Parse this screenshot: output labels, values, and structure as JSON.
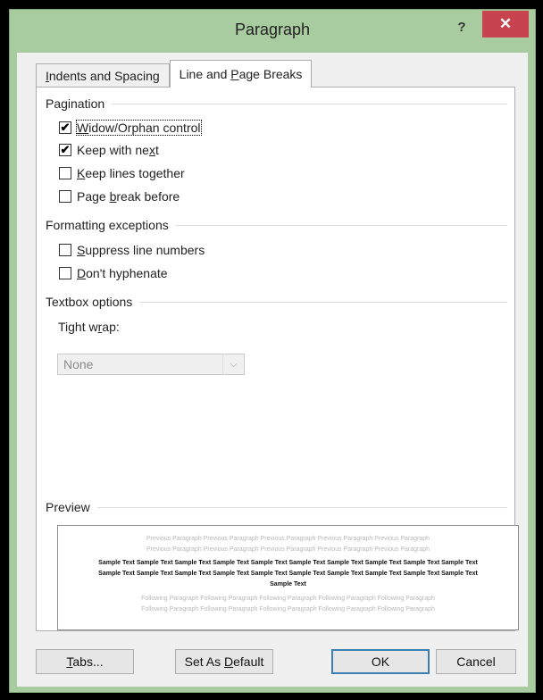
{
  "window": {
    "title": "Paragraph",
    "help_label": "?",
    "close_label": "✕"
  },
  "tabs": [
    {
      "label_pre": "",
      "label_key": "I",
      "label_post": "ndents and Spacing",
      "active": false
    },
    {
      "label_pre": "Line and ",
      "label_key": "P",
      "label_post": "age Breaks",
      "active": true
    }
  ],
  "pagination": {
    "heading": "Pagination",
    "items": [
      {
        "pre": "",
        "key": "W",
        "post": "idow/Orphan control",
        "checked": true
      },
      {
        "pre": "Keep with ne",
        "key": "x",
        "post": "t",
        "checked": true
      },
      {
        "pre": "",
        "key": "K",
        "post": "eep lines together",
        "checked": false
      },
      {
        "pre": "Page ",
        "key": "b",
        "post": "reak before",
        "checked": false
      }
    ]
  },
  "formatting": {
    "heading": "Formatting exceptions",
    "items": [
      {
        "pre": "",
        "key": "S",
        "post": "uppress line numbers",
        "checked": false
      },
      {
        "pre": "",
        "key": "D",
        "post": "on't hyphenate",
        "checked": false
      }
    ]
  },
  "textbox": {
    "heading": "Textbox options",
    "label_pre": "Tight w",
    "label_key": "r",
    "label_post": "ap:",
    "value": "None"
  },
  "preview": {
    "heading": "Preview",
    "previous_line_1": "Previous Paragraph Previous Paragraph Previous Paragraph Previous Paragraph Previous Paragraph",
    "previous_line_2": "Previous Paragraph Previous Paragraph Previous Paragraph Previous Paragraph Previous Paragraph",
    "sample": "Sample Text Sample Text Sample Text Sample Text Sample Text Sample Text Sample Text Sample Text Sample Text Sample Text Sample Text Sample Text Sample Text Sample Text Sample Text Sample Text Sample Text Sample Text Sample Text Sample Text Sample Text",
    "following_line_1": "Following Paragraph Following Paragraph Following Paragraph Following Paragraph Following Paragraph",
    "following_line_2": "Following Paragraph Following Paragraph Following Paragraph Following Paragraph Following Paragraph"
  },
  "buttons": {
    "tabs_pre": "",
    "tabs_key": "T",
    "tabs_post": "abs...",
    "default_pre": "Set As ",
    "default_key": "D",
    "default_post": "efault",
    "ok": "OK",
    "cancel": "Cancel"
  }
}
